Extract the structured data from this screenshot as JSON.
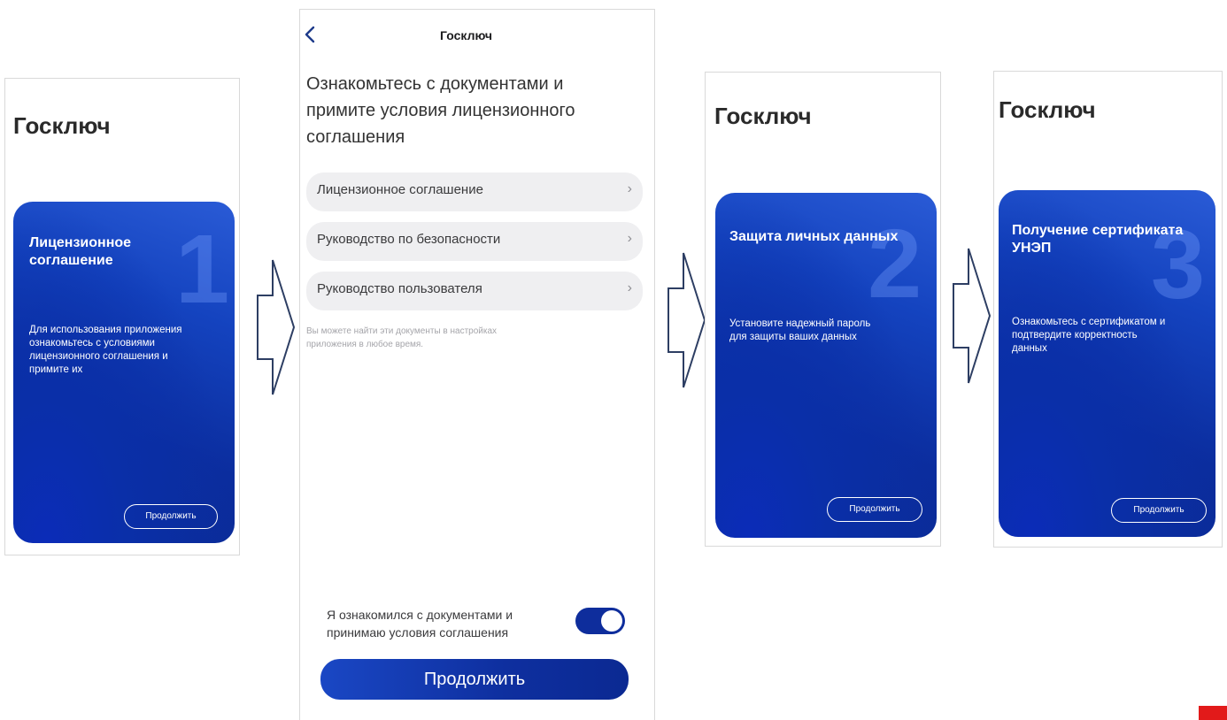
{
  "colors": {
    "card_blue": "#0e2d9c",
    "accent_red": "#e21a1a",
    "arrow_stroke": "#2d3e63"
  },
  "screen1": {
    "app_title": "Госключ",
    "number": "1",
    "title_line1": "Лицензионное",
    "title_line2": "соглашение",
    "text_lines": [
      "Для использования приложения",
      "ознакомьтесь с условиями",
      "лицензионного соглашения и",
      "примите их"
    ],
    "button": "Продолжить"
  },
  "screen2": {
    "nav_title": "Госключ",
    "back_icon": "chevron-left-icon",
    "heading_lines": [
      "Ознакомьтесь с документами и",
      "примите условия лицензионного",
      "соглашения"
    ],
    "documents": [
      {
        "label": "Лицензионное соглашение"
      },
      {
        "label": "Руководство по безопасности"
      },
      {
        "label": "Руководство пользователя"
      }
    ],
    "hint_lines": [
      "Вы можете найти эти документы в настройках",
      "приложения в любое время."
    ],
    "agree_lines": [
      "Я ознакомился с документами и",
      "принимаю условия соглашения"
    ],
    "toggle_on": true,
    "button": "Продолжить"
  },
  "screen3": {
    "app_title": "Госключ",
    "number": "2",
    "title": "Защита личных данных",
    "text_lines": [
      "Установите надежный пароль",
      "для защиты ваших данных"
    ],
    "button": "Продолжить"
  },
  "screen4": {
    "app_title": "Госключ",
    "number": "3",
    "title_line1": "Получение сертификата",
    "title_line2": "УНЭП",
    "text_lines": [
      "Ознакомьтесь с сертификатом и",
      "подтвердите корректность",
      "данных"
    ],
    "button": "Продолжить"
  }
}
